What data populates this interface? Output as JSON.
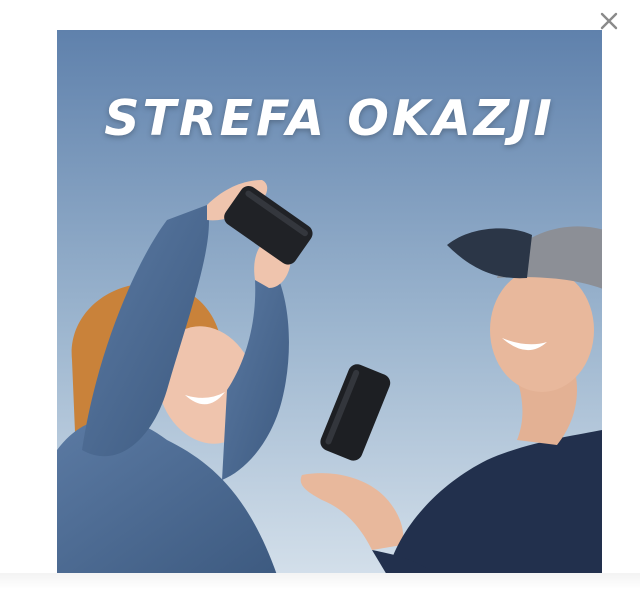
{
  "popup": {
    "headline": "STREFA OKAZJI",
    "close_icon": "close-icon",
    "colors": {
      "sky_top": "#5f81ac",
      "sky_bottom": "#c9d8e6",
      "headline": "#ffffff",
      "denim": "#4d6d96",
      "cap": "#2b3647",
      "speaker": "#202226",
      "sweater": "#22304d"
    }
  }
}
